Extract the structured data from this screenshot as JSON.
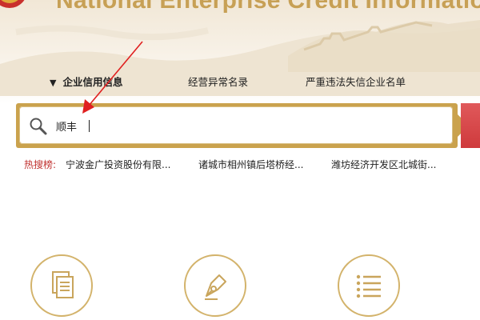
{
  "header": {
    "title": "National Enterprise Credit Information Pub"
  },
  "tabs": [
    {
      "label": "企业信用信息",
      "caret": "▼"
    },
    {
      "label": "经营异常名录"
    },
    {
      "label": "严重违法失信企业名单"
    }
  ],
  "search": {
    "value": "顺丰",
    "placeholder": ""
  },
  "hot_searches": {
    "label": "热搜榜:",
    "items": [
      "宁波金广投资股份有限...",
      "诸城市相州镇后塔桥经...",
      "潍坊经济开发区北城街..."
    ]
  },
  "features": [
    {
      "icon": "document-copy-icon"
    },
    {
      "icon": "pen-nib-icon"
    },
    {
      "icon": "list-icon"
    }
  ],
  "colors": {
    "gold": "#caa24d",
    "gold_text": "#c7a055",
    "red": "#c0312f",
    "annotation_arrow": "#e02020"
  }
}
